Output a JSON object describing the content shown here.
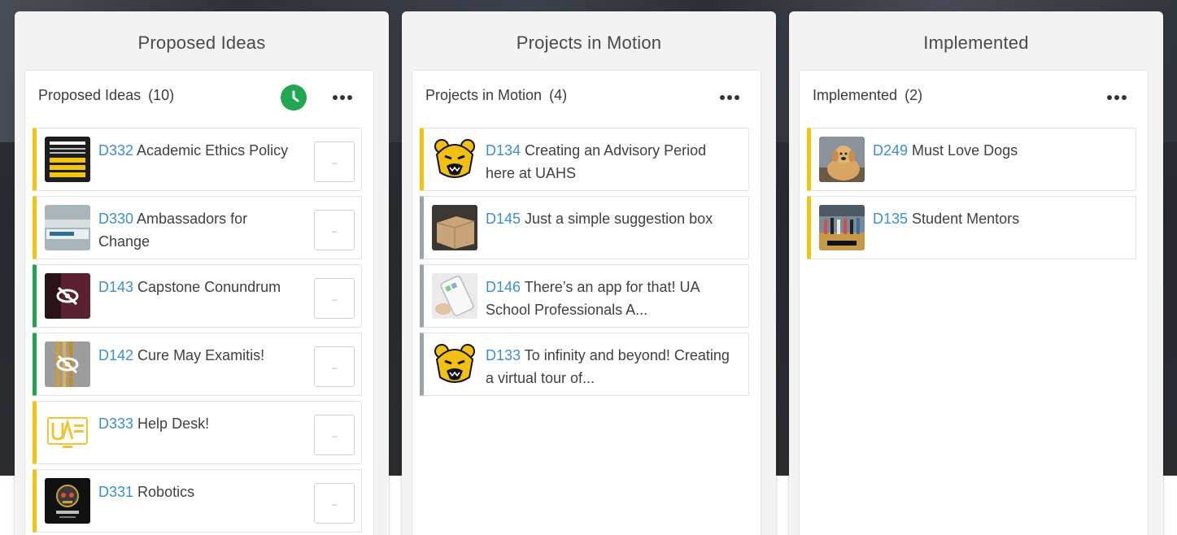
{
  "columns": [
    {
      "title": "Proposed Ideas",
      "panel_title": "Proposed Ideas",
      "count": "(10)",
      "cards": [
        {
          "id": "D332",
          "title": "Academic Ethics Policy",
          "accent": "yellow",
          "thumb": "ethics-policy-thumbnail"
        },
        {
          "id": "D330",
          "title": "Ambassadors for Change",
          "accent": "yellow",
          "thumb": "ambassadors-thumbnail"
        },
        {
          "id": "D143",
          "title": "Capstone Conundrum",
          "accent": "green",
          "thumb": "hidden-image-thumbnail"
        },
        {
          "id": "D142",
          "title": "Cure May Examitis!",
          "accent": "green",
          "thumb": "hidden-image-thumbnail"
        },
        {
          "id": "D333",
          "title": "Help Desk!",
          "accent": "yellow",
          "thumb": "help-desk-logo-thumbnail"
        },
        {
          "id": "D331",
          "title": "Robotics",
          "accent": "yellow",
          "thumb": "robotics-logo-thumbnail"
        }
      ]
    },
    {
      "title": "Projects in Motion",
      "panel_title": "Projects in Motion",
      "count": "(4)",
      "cards": [
        {
          "id": "D134",
          "title": "Creating an Advisory Period here at UAHS",
          "accent": "yellow",
          "thumb": "bear-mascot-thumbnail"
        },
        {
          "id": "D145",
          "title": "Just a simple suggestion box",
          "accent": "grey",
          "thumb": "box-photo-thumbnail"
        },
        {
          "id": "D146",
          "title": "There’s an app for that! UA School Professionals A...",
          "accent": "grey",
          "thumb": "phone-app-thumbnail"
        },
        {
          "id": "D133",
          "title": "To infinity and beyond! Creating a virtual tour of...",
          "accent": "grey",
          "thumb": "bear-mascot-thumbnail"
        }
      ]
    },
    {
      "title": "Implemented",
      "panel_title": "Implemented",
      "count": "(2)",
      "cards": [
        {
          "id": "D249",
          "title": "Must Love Dogs",
          "accent": "yellow",
          "thumb": "dog-photo-thumbnail"
        },
        {
          "id": "D135",
          "title": "Student Mentors",
          "accent": "yellow",
          "thumb": "gym-photo-thumbnail"
        }
      ]
    }
  ],
  "vote_placeholder": "–",
  "icons": {
    "clock": "clock-icon",
    "more": "more-options-icon"
  },
  "colors": {
    "accent_yellow": "#f2c310",
    "accent_green": "#1fa44f",
    "accent_grey": "#9aa4ab",
    "link_blue": "#3a8fd3",
    "clock_green": "#21a651"
  }
}
